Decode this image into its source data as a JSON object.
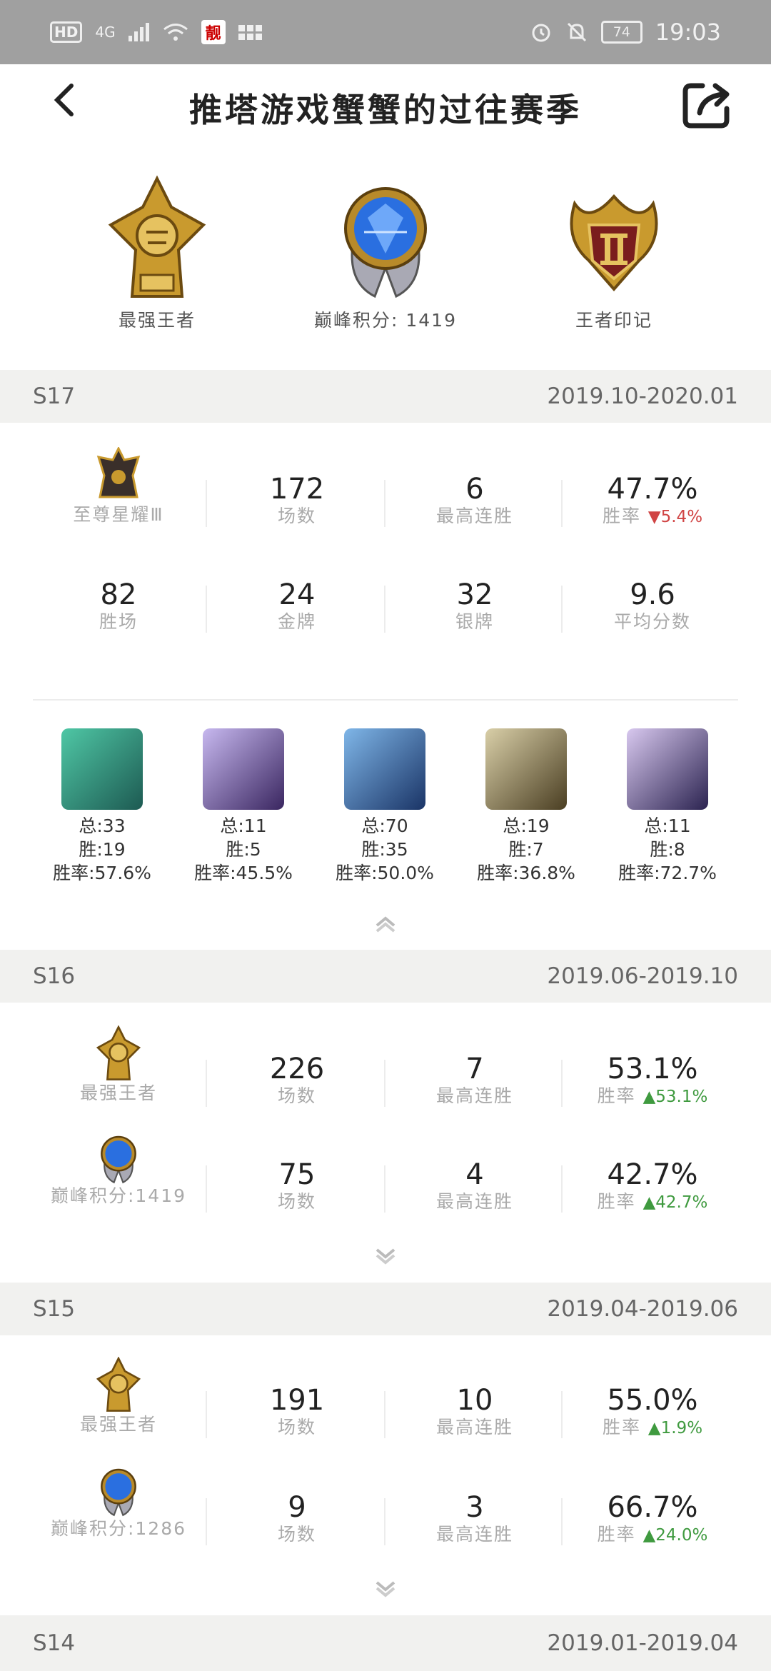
{
  "status": {
    "hd": "HD",
    "signal": "4G",
    "app_icon_char": "靓",
    "battery": "74",
    "time": "19:03"
  },
  "header": {
    "title": "推塔游戏蟹蟹的过往赛季",
    "back_icon": "chevron-left-icon",
    "share_icon": "share-icon"
  },
  "badges": [
    {
      "label": "最强王者",
      "icon": "king-crest-icon"
    },
    {
      "label": "巅峰积分: 1419",
      "icon": "peak-orb-icon"
    },
    {
      "label": "王者印记",
      "icon": "king-mark-icon"
    }
  ],
  "seasons": [
    {
      "name": "S17",
      "range": "2019.10-2020.01",
      "rank_label": "至尊星耀Ⅲ",
      "row1": {
        "games": "172",
        "games_lbl": "场数",
        "streak": "6",
        "streak_lbl": "最高连胜",
        "winrate": "47.7%",
        "winrate_lbl": "胜率",
        "delta": "▼5.4%"
      },
      "row2": [
        {
          "val": "82",
          "lbl": "胜场"
        },
        {
          "val": "24",
          "lbl": "金牌"
        },
        {
          "val": "32",
          "lbl": "银牌"
        },
        {
          "val": "9.6",
          "lbl": "平均分数"
        }
      ],
      "heroes": [
        {
          "total": "总:33",
          "wins": "胜:19",
          "rate": "胜率:57.6%",
          "color": "#2f8f7a"
        },
        {
          "total": "总:11",
          "wins": "胜:5",
          "rate": "胜率:45.5%",
          "color": "#6a4f8f"
        },
        {
          "total": "总:70",
          "wins": "胜:35",
          "rate": "胜率:50.0%",
          "color": "#2f5a9a"
        },
        {
          "total": "总:19",
          "wins": "胜:7",
          "rate": "胜率:36.8%",
          "color": "#8a7a4a"
        },
        {
          "total": "总:11",
          "wins": "胜:8",
          "rate": "胜率:72.7%",
          "color": "#5a4a8a"
        }
      ]
    },
    {
      "name": "S16",
      "range": "2019.06-2019.10",
      "rows": [
        {
          "rank_label": "最强王者",
          "games": "226",
          "games_lbl": "场数",
          "streak": "7",
          "streak_lbl": "最高连胜",
          "winrate": "53.1%",
          "winrate_lbl": "胜率",
          "delta": "▲53.1%"
        },
        {
          "rank_label": "巅峰积分:1419",
          "games": "75",
          "games_lbl": "场数",
          "streak": "4",
          "streak_lbl": "最高连胜",
          "winrate": "42.7%",
          "winrate_lbl": "胜率",
          "delta": "▲42.7%"
        }
      ]
    },
    {
      "name": "S15",
      "range": "2019.04-2019.06",
      "rows": [
        {
          "rank_label": "最强王者",
          "games": "191",
          "games_lbl": "场数",
          "streak": "10",
          "streak_lbl": "最高连胜",
          "winrate": "55.0%",
          "winrate_lbl": "胜率",
          "delta": "▲1.9%"
        },
        {
          "rank_label": "巅峰积分:1286",
          "games": "9",
          "games_lbl": "场数",
          "streak": "3",
          "streak_lbl": "最高连胜",
          "winrate": "66.7%",
          "winrate_lbl": "胜率",
          "delta": "▲24.0%"
        }
      ]
    },
    {
      "name": "S14",
      "range": "2019.01-2019.04"
    }
  ],
  "colors": {
    "season_bar": "#f1f1ef",
    "down": "#d04444",
    "up": "#3f9a3f",
    "gold": "#c99a2e",
    "blue_orb": "#2a6fe0"
  }
}
